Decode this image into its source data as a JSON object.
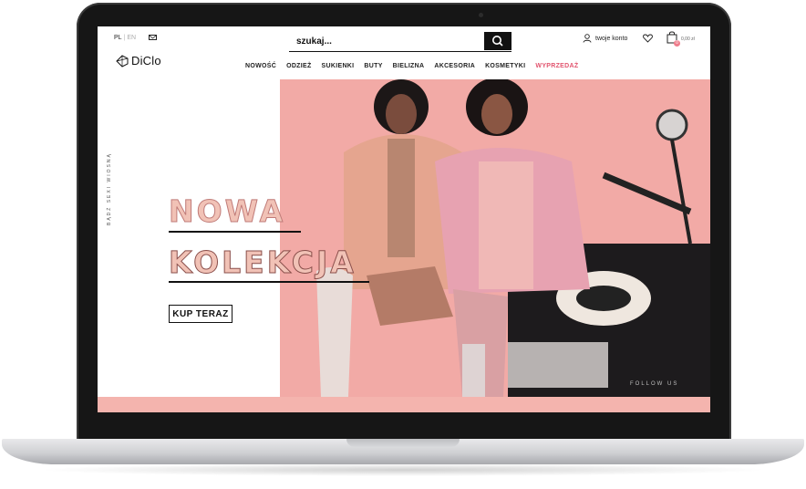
{
  "header": {
    "lang_active": "PL",
    "lang_inactive": "EN",
    "search_placeholder": "szukaj...",
    "account_label": "twoje konto",
    "cart_total": "0,00 zł",
    "cart_count": "0"
  },
  "logo": {
    "text": "DiClo"
  },
  "nav": {
    "items": [
      "NOWOŚĆ",
      "ODZIEŻ",
      "SUKIENKI",
      "BUTY",
      "BIELIZNA",
      "AKCESORIA",
      "KOSMETYKI"
    ],
    "sale": "WYPRZEDAŻ"
  },
  "hero": {
    "side_tag": "BĄDŹ SEXI WIOSNĄ",
    "headline_1": "NOWA",
    "headline_2": "KOLEKCJA",
    "cta": "KUP TERAZ",
    "follow": "FOLLOW US",
    "accent_color": "#f2aaa6"
  }
}
